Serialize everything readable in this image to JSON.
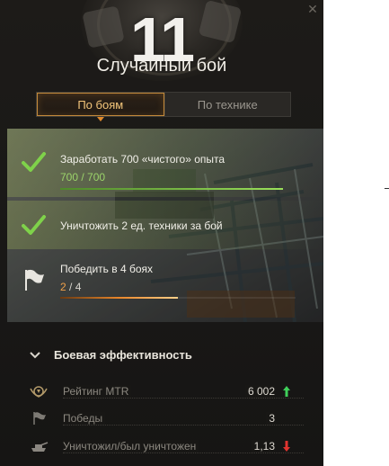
{
  "header": {
    "battle_count": "11",
    "title": "Случайный бой"
  },
  "tabs": [
    {
      "label": "По боям",
      "active": true
    },
    {
      "label": "По технике",
      "active": false
    }
  ],
  "missions": [
    {
      "label": "Заработать 700 «чистого» опыта",
      "progress_text": "700 / 700",
      "progress": 1.0,
      "completed": true,
      "icon": "checkmark-icon"
    },
    {
      "label": "Уничтожить 2 ед. техники за бой",
      "progress_text": "",
      "progress": 1.0,
      "completed": true,
      "icon": "checkmark-icon"
    },
    {
      "label": "Победить в 4 боях",
      "progress_current": "2",
      "progress_sep": " / ",
      "progress_total": "4",
      "progress": 0.5,
      "completed": false,
      "icon": "flag-icon"
    }
  ],
  "effectiveness": {
    "title": "Боевая эффективность",
    "stats": [
      {
        "label": "Рейтинг MTR",
        "value": "6 002",
        "trend": "up",
        "icon": "rating-emblem-icon"
      },
      {
        "label": "Победы",
        "value": "3",
        "trend": "none",
        "icon": "flag-icon"
      },
      {
        "label": "Уничтожил/был уничтожен",
        "value": "1,13",
        "trend": "down",
        "icon": "tank-icon"
      }
    ]
  },
  "colors": {
    "accent": "#f3c57a",
    "progress_green": "#8fd14f",
    "progress_orange": "#e8862a",
    "trend_up": "#3fcf5a",
    "trend_down": "#e0342f"
  }
}
